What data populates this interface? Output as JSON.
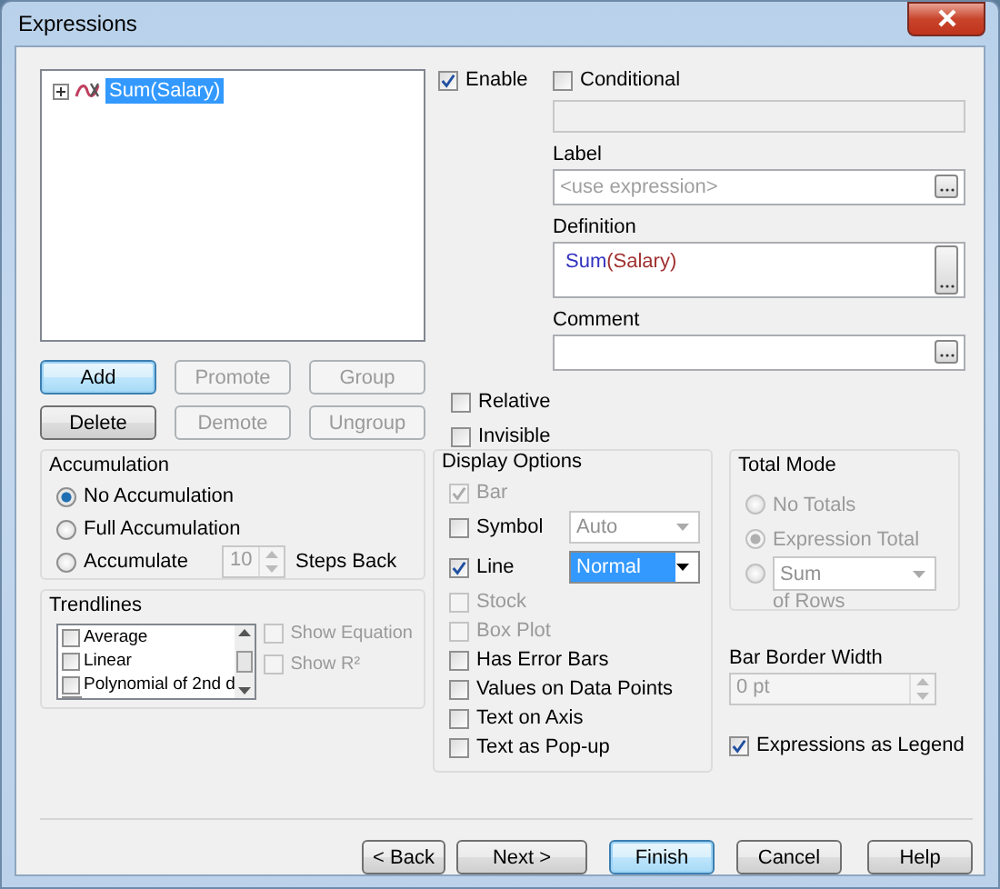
{
  "window": {
    "title": "Expressions"
  },
  "tree": [
    {
      "label": "Sum(Salary)",
      "selected": true,
      "expanded": false
    }
  ],
  "list_buttons": [
    {
      "label": "Add",
      "disabled": false,
      "focused": true
    },
    {
      "label": "Promote",
      "disabled": true,
      "focused": false
    },
    {
      "label": "Group",
      "disabled": true,
      "focused": false
    },
    {
      "label": "Delete",
      "disabled": false,
      "focused": false
    },
    {
      "label": "Demote",
      "disabled": true,
      "focused": false
    },
    {
      "label": "Ungroup",
      "disabled": true,
      "focused": false
    }
  ],
  "enable": {
    "label": "Enable",
    "checked": true
  },
  "conditional": {
    "label": "Conditional",
    "checked": false
  },
  "label_field": {
    "label": "Label",
    "placeholder": "<use expression>"
  },
  "definition": {
    "label": "Definition",
    "parts": [
      {
        "text": "Sum",
        "color": "#3030c0"
      },
      {
        "text": "(Salary)",
        "color": "#a03030"
      }
    ]
  },
  "comment": {
    "label": "Comment"
  },
  "flags": [
    {
      "label": "Relative",
      "checked": false
    },
    {
      "label": "Invisible",
      "checked": false
    }
  ],
  "accumulation": {
    "title": "Accumulation",
    "options": [
      {
        "label": "No Accumulation",
        "selected": true
      },
      {
        "label": "Full Accumulation",
        "selected": false
      },
      {
        "label": "Accumulate",
        "selected": false
      }
    ],
    "steps_value": "10",
    "steps_label": "Steps Back"
  },
  "trendlines": {
    "title": "Trendlines",
    "items": [
      {
        "label": "Average",
        "checked": false
      },
      {
        "label": "Linear",
        "checked": false
      },
      {
        "label": "Polynomial of 2nd d",
        "checked": false
      }
    ],
    "options": [
      {
        "label": "Show Equation",
        "checked": false,
        "disabled": true
      },
      {
        "label": "Show R²",
        "checked": false,
        "disabled": true
      }
    ]
  },
  "display_options": {
    "title": "Display Options",
    "items": [
      {
        "label": "Bar",
        "checked": true,
        "disabled": true
      },
      {
        "label": "Symbol",
        "checked": false,
        "disabled": false,
        "dropdown": {
          "value": "Auto",
          "disabled": true
        }
      },
      {
        "label": "Line",
        "checked": true,
        "disabled": false,
        "dropdown": {
          "value": "Normal",
          "disabled": false
        }
      },
      {
        "label": "Stock",
        "checked": false,
        "disabled": true
      },
      {
        "label": "Box Plot",
        "checked": false,
        "disabled": true
      },
      {
        "label": "Has Error Bars",
        "checked": false,
        "disabled": false
      },
      {
        "label": "Values on Data Points",
        "checked": false,
        "disabled": false
      },
      {
        "label": "Text on Axis",
        "checked": false,
        "disabled": false
      },
      {
        "label": "Text as Pop-up",
        "checked": false,
        "disabled": false
      }
    ]
  },
  "total_mode": {
    "title": "Total Mode",
    "disabled": true,
    "options": [
      {
        "kind": "text",
        "label": "No Totals",
        "selected": false
      },
      {
        "kind": "text",
        "label": "Expression Total",
        "selected": true
      },
      {
        "kind": "dropdown",
        "value": "Sum",
        "selected": false
      }
    ],
    "suffix": "of Rows"
  },
  "bar_border_width": {
    "label": "Bar Border Width",
    "value": "0 pt",
    "disabled": true
  },
  "expressions_as_legend": {
    "label": "Expressions as Legend",
    "checked": true
  },
  "footer_buttons": [
    {
      "label": "< Back",
      "focused": false
    },
    {
      "label": "Next >",
      "focused": false
    },
    {
      "label": "Finish",
      "focused": true
    },
    {
      "label": "Cancel",
      "focused": false
    },
    {
      "label": "Help",
      "focused": false
    }
  ]
}
